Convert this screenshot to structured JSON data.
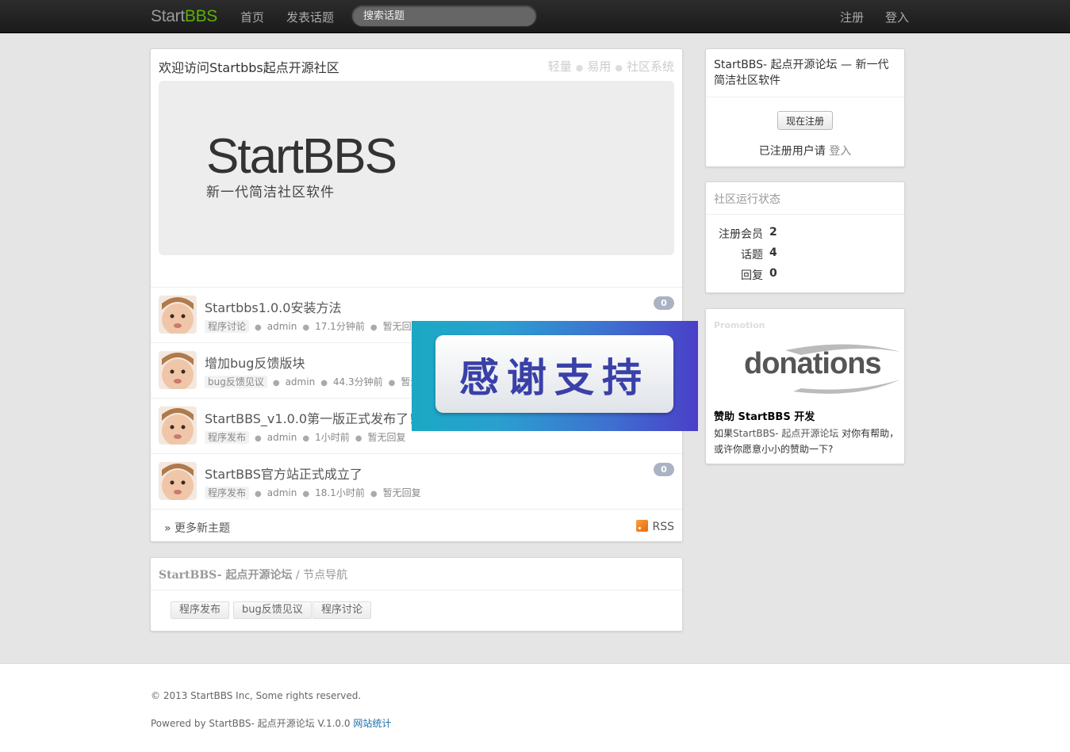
{
  "navbar": {
    "brand_start": "Start",
    "brand_bbs": "BBS",
    "links": [
      "首页",
      "发表话题"
    ],
    "search_placeholder": "搜索话题",
    "right_links": [
      "注册",
      "登入"
    ]
  },
  "welcome": {
    "title": "欢迎访问Startbbs起点开源社区",
    "tagline": [
      "轻量",
      "易用",
      "社区系统"
    ],
    "hero_title": "StartBBS",
    "hero_subtitle": "新一代简洁社区软件"
  },
  "topics": [
    {
      "title": "Startbbs1.0.0安装方法",
      "node": "程序讨论",
      "author": "admin",
      "time": "17.1分钟前",
      "reply": "暂无回复",
      "count": "0"
    },
    {
      "title": "增加bug反馈版块",
      "node": "bug反馈见议",
      "author": "admin",
      "time": "44.3分钟前",
      "reply": "暂无回复",
      "count": ""
    },
    {
      "title": "StartBBS_v1.0.0第一版正式发布了！",
      "node": "程序发布",
      "author": "admin",
      "time": "1小时前",
      "reply": "暂无回复",
      "count": ""
    },
    {
      "title": "StartBBS官方站正式成立了",
      "node": "程序发布",
      "author": "admin",
      "time": "18.1小时前",
      "reply": "暂无回复",
      "count": "0"
    }
  ],
  "list_footer": {
    "more": "» 更多新主题",
    "rss": "RSS"
  },
  "node_nav": {
    "site": "StartBBS- 起点开源论坛",
    "sep_title": " / 节点导航",
    "nodes": [
      "程序发布",
      "bug反馈见议",
      "程序讨论"
    ]
  },
  "sidebar": {
    "intro": "StartBBS- 起点开源论坛 — 新一代简洁社区软件",
    "register_button": "现在注册",
    "login_prefix": "已注册用户请 ",
    "login_link": "登入",
    "stats_title": "社区运行状态",
    "stats": [
      {
        "label": "注册会员",
        "value": "2"
      },
      {
        "label": "话题",
        "value": "4"
      },
      {
        "label": "回复",
        "value": "0"
      }
    ],
    "promo_head": "Promotion",
    "donations_logo": "donations",
    "promo_title": "赞助 StartBBS 开发",
    "promo_text_1": "如果",
    "promo_text_site": "StartBBS- 起点开源论坛",
    "promo_text_2": " 对你有帮助，或许你愿意小小的赞助一下?"
  },
  "overlay": {
    "text": "感谢支持"
  },
  "footer": {
    "copyright": "© 2013 StartBBS Inc, Some rights reserved.",
    "powered": "Powered by StartBBS- 起点开源论坛 V.1.0.0 ",
    "stats_link": "网站统计"
  }
}
